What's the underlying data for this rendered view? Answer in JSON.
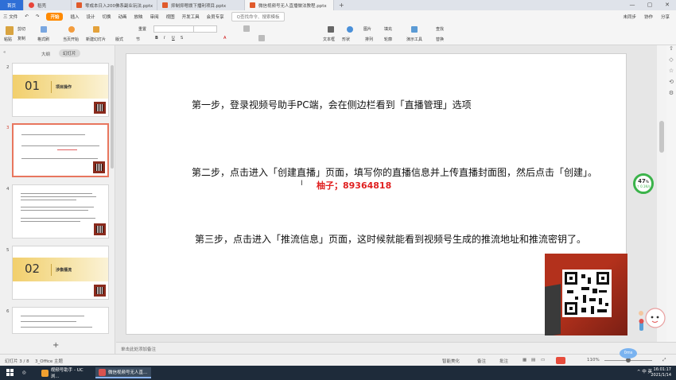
{
  "tabs": [
    {
      "label": "首页",
      "type": "home"
    },
    {
      "label": "稻壳",
      "color": "#e8443a"
    },
    {
      "label": "零成本日入200佛系副业玩法.pptx",
      "color": "#e05a2b"
    },
    {
      "label": "抑制抑嗯拨下播利项目.pptx",
      "color": "#e05a2b"
    },
    {
      "label": "微信视频号无人直播做法教程.pptx",
      "color": "#e05a2b",
      "active": true
    }
  ],
  "menubar": {
    "file": "三 文件",
    "items": [
      "开始",
      "插入",
      "设计",
      "切换",
      "动画",
      "放映",
      "审阅",
      "视图",
      "开发工具",
      "会员专享"
    ],
    "active": "开始",
    "search": "Q查找命令、搜索模板",
    "right": [
      "未同步",
      "协作",
      "分享"
    ]
  },
  "ribbon": {
    "paste": "粘贴",
    "cut": "剪切",
    "copy": "复制",
    "format_painter": "格式刷",
    "current_slide": "当页开始",
    "new_slide": "新建幻灯片",
    "layout": "版式",
    "section": "节",
    "reset": "重置",
    "textbox": "文本框",
    "shape": "形状",
    "arrange": "排列",
    "picture": "图片",
    "fill": "填充",
    "outline": "轮廓",
    "slide_tools": "演示工具",
    "find": "查找",
    "replace": "替换"
  },
  "panel": {
    "collapse": "«",
    "outline_tab": "大纲",
    "thumbs_tab": "幻灯片",
    "slides": [
      {
        "num": "2",
        "bignum": "01",
        "title": "项目操作",
        "type": "section"
      },
      {
        "num": "3",
        "type": "text",
        "selected": true
      },
      {
        "num": "4",
        "type": "text"
      },
      {
        "num": "5",
        "bignum": "02",
        "title": "涉像播流",
        "type": "section"
      },
      {
        "num": "6",
        "type": "text"
      }
    ],
    "add": "+"
  },
  "slide": {
    "step1": "第一步，登录视频号助手PC端，会在侧边栏看到「直播管理」选项",
    "step2": "第二步，点击进入「创建直播」页面，填写你的直播信息并上传直播封面图，然后点击「创建」。",
    "note": "柚子；89364818",
    "step3": "第三步，点击进入「推流信息」页面，这时候就能看到视频号生成的推流地址和推流密钥了。"
  },
  "notes_placeholder": "单击此处添加备注",
  "progress": {
    "percent": "47",
    "unit": "%",
    "speed": "↑ 0.1K/s"
  },
  "statusbar": {
    "slide_info": "幻灯片 3 / 8",
    "theme": "3_Office 主题",
    "smart": "智能美化",
    "notes": "备注",
    "comments": "批注",
    "zoom": "110%",
    "bubble": "0ms"
  },
  "taskbar": {
    "apps": [
      {
        "label": "视频号助手 - UC浏...",
        "color": "#f0a030"
      },
      {
        "label": "微信视频号无人直...",
        "color": "#d9534f",
        "active": true
      }
    ],
    "tray": "^ 中 英",
    "time": "16:01:17",
    "date": "2021/1/14"
  }
}
